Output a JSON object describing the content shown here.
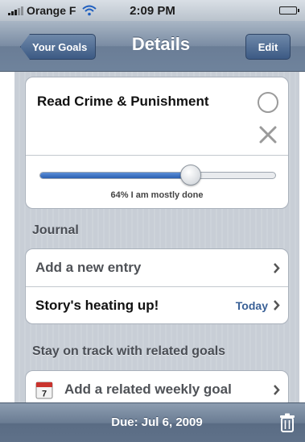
{
  "status_bar": {
    "carrier": "Orange F",
    "time": "2:09 PM"
  },
  "nav": {
    "back_label": "Your Goals",
    "title": "Details",
    "edit_label": "Edit"
  },
  "goal": {
    "title": "Read Crime & Punishment",
    "progress_fraction": 0.64,
    "progress_text": "64% I am mostly done"
  },
  "journal": {
    "header": "Journal",
    "add_entry_label": "Add a new entry",
    "entries": [
      {
        "title": "Story's heating up!",
        "date": "Today"
      }
    ]
  },
  "related": {
    "header": "Stay on track with related goals",
    "add_weekly_label": "Add a related weekly goal",
    "calendar_day": "7"
  },
  "toolbar": {
    "due_label": "Due: Jul 6, 2009"
  },
  "colors": {
    "nav_bar": "#7a8ca3",
    "accent_blue": "#2a5fb0",
    "detail_blue": "#3a6197",
    "group_background": "#c8ced6"
  }
}
